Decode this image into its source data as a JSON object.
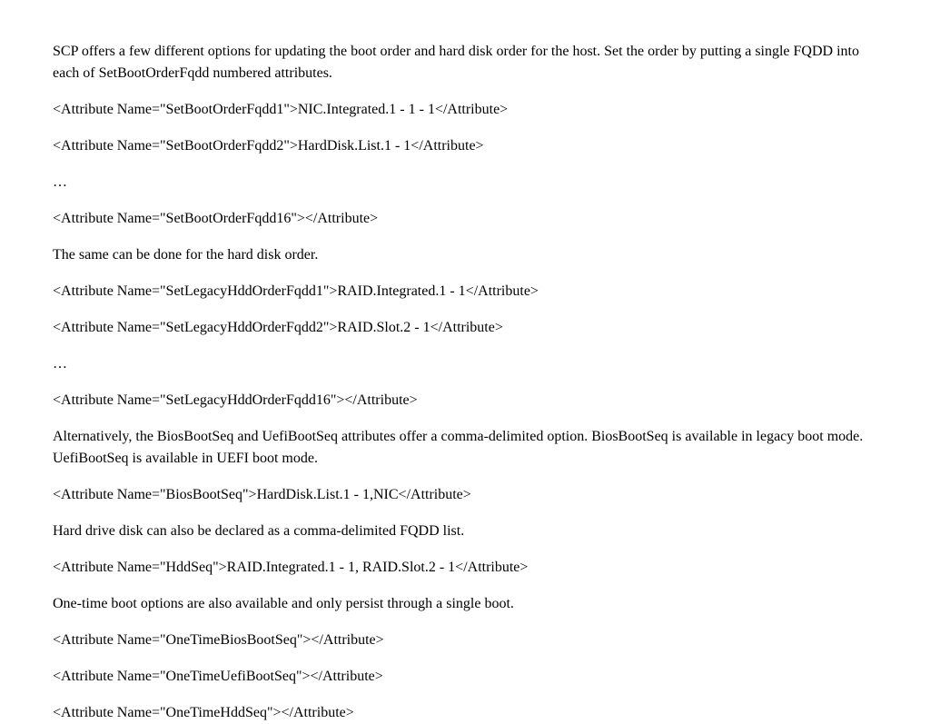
{
  "paragraphs": {
    "p1": "SCP offers a few different options for updating the boot order and hard disk order for the host. Set the order by putting a single FQDD into each of SetBootOrderFqdd numbered attributes.",
    "p2": "<Attribute Name=\"SetBootOrderFqdd1\">NIC.Integrated.1 - 1 - 1</Attribute>",
    "p3": "<Attribute Name=\"SetBootOrderFqdd2\">HardDisk.List.1 - 1</Attribute>",
    "p4": "…",
    "p5": "<Attribute Name=\"SetBootOrderFqdd16\"></Attribute>",
    "p6": "The same can be done for the hard disk order.",
    "p7": "<Attribute Name=\"SetLegacyHddOrderFqdd1\">RAID.Integrated.1 - 1</Attribute>",
    "p8": "<Attribute Name=\"SetLegacyHddOrderFqdd2\">RAID.Slot.2 - 1</Attribute>",
    "p9": "…",
    "p10": "<Attribute Name=\"SetLegacyHddOrderFqdd16\"></Attribute>",
    "p11": "Alternatively, the BiosBootSeq and UefiBootSeq attributes offer a comma-delimited option. BiosBootSeq is available in legacy boot mode. UefiBootSeq is available in UEFI boot mode.",
    "p12": "<Attribute Name=\"BiosBootSeq\">HardDisk.List.1 - 1,NIC</Attribute>",
    "p13": "Hard drive disk can also be declared as a comma-delimited FQDD list.",
    "p14": "<Attribute Name=\"HddSeq\">RAID.Integrated.1 - 1, RAID.Slot.2 - 1</Attribute>",
    "p15": "One-time boot options are also available and only persist through a single boot.",
    "p16": "<Attribute Name=\"OneTimeBiosBootSeq\"></Attribute>",
    "p17": "<Attribute Name=\"OneTimeUefiBootSeq\"></Attribute>",
    "p18": "<Attribute Name=\"OneTimeHddSeq\"></Attribute>"
  }
}
